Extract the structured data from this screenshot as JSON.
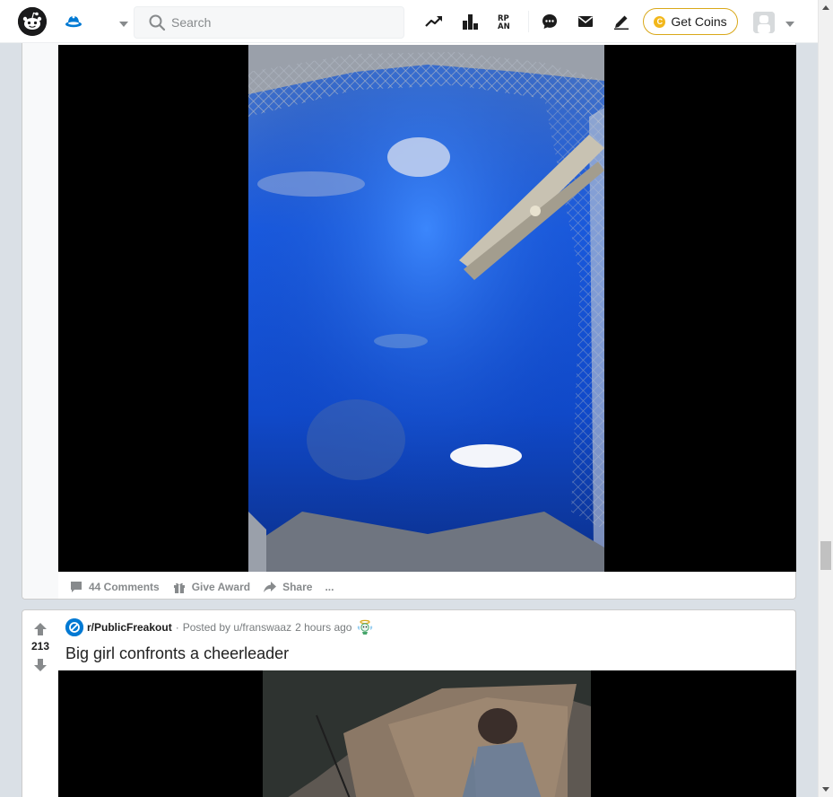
{
  "header": {
    "search_placeholder": "Search",
    "coins_label": "Get Coins",
    "coin_symbol": "C"
  },
  "post_1": {
    "actions": {
      "comments_label": "44 Comments",
      "award_label": "Give Award",
      "share_label": "Share",
      "more_label": "..."
    }
  },
  "post_2": {
    "score": "213",
    "subreddit": "r/PublicFreakout",
    "meta_separator": "·",
    "posted_by": "Posted by u/franswaaz",
    "time": "2 hours ago",
    "title": "Big girl confronts a cheerleader"
  },
  "colors": {
    "brand": "#ff4500",
    "accent_blue": "#0079d3",
    "coin_gold": "#f2b71b",
    "page_bg": "#dae0e6"
  },
  "icons": {
    "logo": "reddit-logo-icon",
    "home": "home-icon",
    "trending": "trending-icon",
    "leaderboard": "leaderboard-icon",
    "rpan": "rpan-icon",
    "chat": "chat-icon",
    "mail": "mail-icon",
    "create": "pencil-icon"
  }
}
